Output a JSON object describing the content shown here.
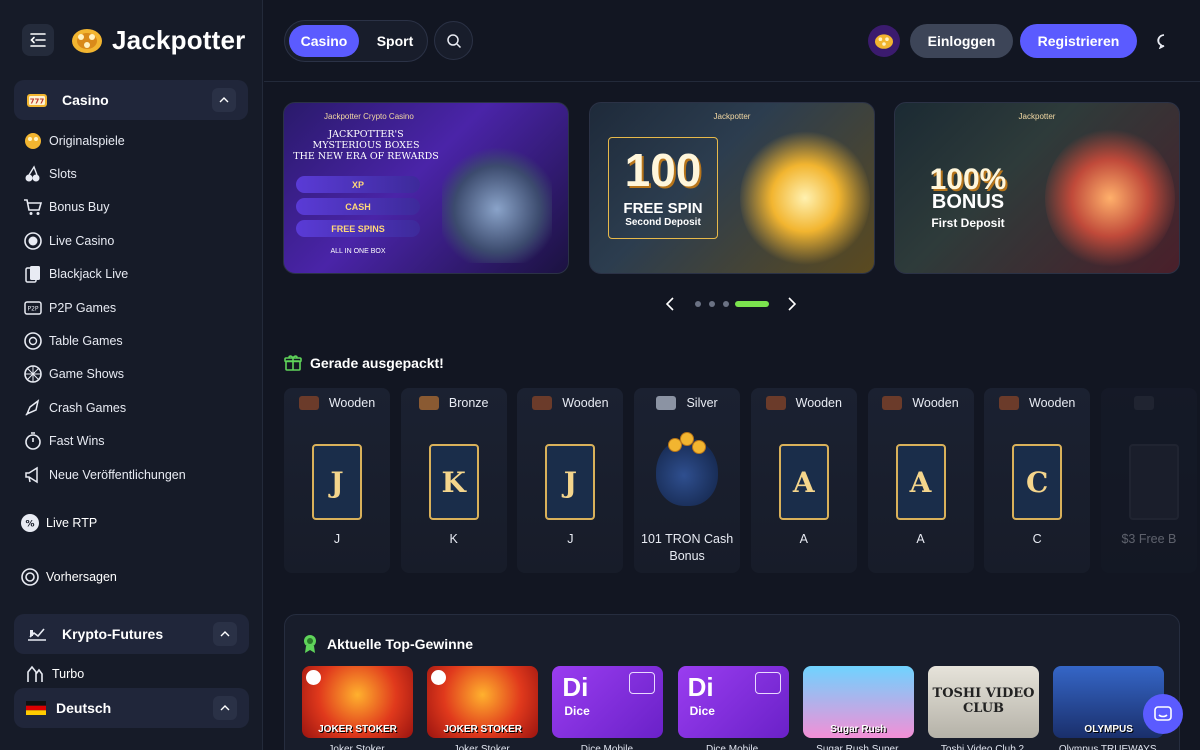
{
  "brand": {
    "name": "Jackpotter"
  },
  "sidebar": {
    "casino_section": {
      "title": "Casino"
    },
    "items": [
      {
        "label": "Originalspiele",
        "icon": "cards-logo-icon"
      },
      {
        "label": "Slots",
        "icon": "cherries-icon"
      },
      {
        "label": "Bonus Buy",
        "icon": "cart-icon"
      },
      {
        "label": "Live Casino",
        "icon": "live-circle-icon"
      },
      {
        "label": "Blackjack Live",
        "icon": "playing-cards-icon"
      },
      {
        "label": "P2P Games",
        "icon": "p2p-icon"
      },
      {
        "label": "Table Games",
        "icon": "poker-chip-icon"
      },
      {
        "label": "Game Shows",
        "icon": "wheel-icon"
      },
      {
        "label": "Crash Games",
        "icon": "rocket-icon"
      },
      {
        "label": "Fast Wins",
        "icon": "stopwatch-icon"
      },
      {
        "label": "Neue Veröffentlichungen",
        "icon": "megaphone-icon"
      }
    ],
    "live_rtp": {
      "label": "Live RTP",
      "icon": "percent-icon"
    },
    "predictions": {
      "label": "Vorhersagen",
      "icon": "target-icon"
    },
    "futures_section": {
      "title": "Krypto-Futures"
    },
    "turbo": {
      "label": "Turbo",
      "icon": "turbo-icon"
    },
    "language": {
      "label": "Deutsch"
    }
  },
  "header": {
    "tabs": {
      "casino": "Casino",
      "sport": "Sport"
    },
    "login": "Einloggen",
    "register": "Registrieren"
  },
  "banners": [
    {
      "brand": "Jackpotter Crypto Casino",
      "heading_lines": [
        "JACKPOTTER'S",
        "MYSTERIOUS BOXES",
        "THE NEW ERA OF REWARDS"
      ],
      "pills": [
        "XP",
        "CASH",
        "FREE SPINS"
      ],
      "footer": "ALL IN ONE BOX"
    },
    {
      "brand": "Jackpotter",
      "big": "100",
      "line1": "FREE SPIN",
      "line2": "Second Deposit"
    },
    {
      "brand": "Jackpotter",
      "big": "100%",
      "line1": "BONUS",
      "line2": "First Deposit"
    }
  ],
  "carousel": {
    "dots": 4,
    "active_index": 3
  },
  "unpacked": {
    "title": "Gerade ausgepackt!",
    "boxes": [
      {
        "tier": "Wooden",
        "card": "J",
        "name": "J",
        "chest_color": "#6b3b2a"
      },
      {
        "tier": "Bronze",
        "card": "K",
        "name": "K",
        "chest_color": "#8a5a32"
      },
      {
        "tier": "Wooden",
        "card": "J",
        "name": "J",
        "chest_color": "#6b3b2a"
      },
      {
        "tier": "Silver",
        "card": "",
        "name": "101 TRON Cash Bonus",
        "chest_color": "#8b93a3"
      },
      {
        "tier": "Wooden",
        "card": "A",
        "name": "A",
        "chest_color": "#6b3b2a"
      },
      {
        "tier": "Wooden",
        "card": "A",
        "name": "A",
        "chest_color": "#6b3b2a"
      },
      {
        "tier": "Wooden",
        "card": "C",
        "name": "C",
        "chest_color": "#6b3b2a"
      },
      {
        "tier": "",
        "card": "",
        "name": "$3 Free B",
        "chest_color": "#3a3f4d"
      }
    ]
  },
  "top_wins": {
    "title": "Aktuelle Top-Gewinne",
    "games": [
      {
        "art": "JOKER STOKER",
        "caption": "Joker Stoker",
        "style": "joker"
      },
      {
        "art": "JOKER STOKER",
        "caption": "Joker Stoker",
        "style": "joker"
      },
      {
        "art": "Di",
        "sub": "Dice",
        "caption": "Dice Mobile",
        "style": "dice"
      },
      {
        "art": "Di",
        "sub": "Dice",
        "caption": "Dice Mobile",
        "style": "dice"
      },
      {
        "art": "Sugar Rush",
        "caption": "Sugar Rush Super",
        "style": "sugar"
      },
      {
        "art": "TOSHI VIDEO CLUB",
        "caption": "Toshi Video Club 2",
        "style": "toshi"
      },
      {
        "art": "OLYMPUS",
        "caption": "Olympus TRUEWAYS",
        "style": "olympus"
      }
    ]
  },
  "colors": {
    "accent": "#5b5bff",
    "active_dot": "#7be34e",
    "bg": "#121622",
    "sidebar": "#161b28"
  }
}
